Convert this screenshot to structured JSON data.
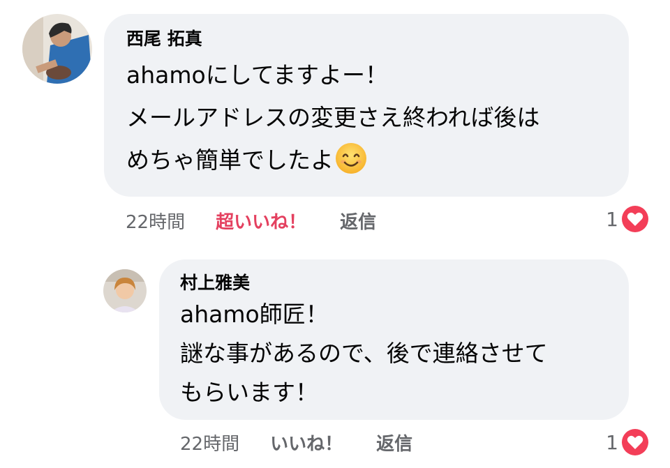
{
  "comments": [
    {
      "author": "西尾 拓真",
      "lines": [
        "ahamoにしてますよー！",
        "メールアドレスの変更さえ終われば後は",
        "めちゃ簡単でしたよ"
      ],
      "emoji": "smiling-face-emoji",
      "time": "22時間",
      "like_label": "超いいね！",
      "like_state": "active",
      "reply_label": "返信",
      "reaction_count": "1",
      "reaction_icon": "heart-icon"
    },
    {
      "author": "村上雅美",
      "lines": [
        "ahamo師匠！",
        "謎な事があるので、後で連絡させて",
        "もらいます！"
      ],
      "time": "22時間",
      "like_label": "いいね！",
      "reply_label": "返信",
      "reaction_count": "1",
      "reaction_icon": "heart-icon"
    }
  ],
  "colors": {
    "bubble": "#f0f2f5",
    "meta_text": "#65676b",
    "love_reaction": "#f33e58",
    "active_like": "#e4405f"
  }
}
